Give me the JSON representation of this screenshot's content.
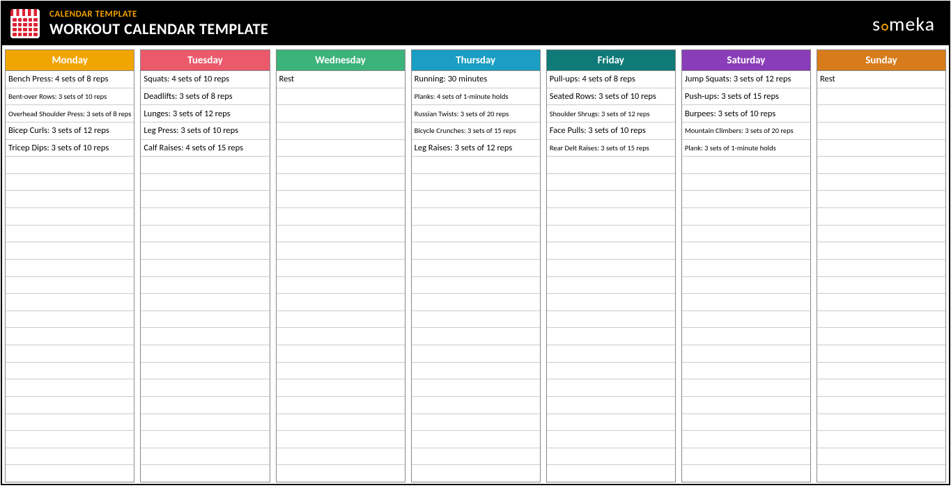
{
  "header": {
    "subtitle": "CALENDAR TEMPLATE",
    "title": "WORKOUT CALENDAR TEMPLATE",
    "brand": "someka"
  },
  "rows_per_col": 24,
  "days": [
    {
      "name": "Monday",
      "color": "#f0a500",
      "entries": [
        "Bench Press: 4 sets of 8 reps",
        "Bent-over Rows: 3 sets of 10 reps",
        "Overhead Shoulder Press: 3 sets of 8 reps",
        "Bicep Curls: 3 sets of 12 reps",
        "Tricep Dips: 3 sets of 10 reps"
      ]
    },
    {
      "name": "Tuesday",
      "color": "#ea5a6b",
      "entries": [
        "Squats: 4 sets of 10 reps",
        "Deadlifts: 3 sets of 8 reps",
        "Lunges: 3 sets of 12 reps",
        "Leg Press: 3 sets of 10 reps",
        "Calf Raises: 4 sets of 15 reps"
      ]
    },
    {
      "name": "Wednesday",
      "color": "#3cb37a",
      "entries": [
        "Rest"
      ]
    },
    {
      "name": "Thursday",
      "color": "#1a9ec3",
      "entries": [
        "Running: 30 minutes",
        "Planks: 4 sets of 1-minute holds",
        "Russian Twists: 3 sets of 20 reps",
        "Bicycle Crunches: 3 sets of 15 reps",
        "Leg Raises: 3 sets of 12 reps"
      ]
    },
    {
      "name": "Friday",
      "color": "#0f7a78",
      "entries": [
        "Pull-ups: 4 sets of 8 reps",
        "Seated Rows: 3 sets of 10 reps",
        "Shoulder Shrugs: 3 sets of 12 reps",
        "Face Pulls: 3 sets of 10 reps",
        "Rear Delt Raises: 3 sets of 15 reps"
      ]
    },
    {
      "name": "Saturday",
      "color": "#8a3db8",
      "entries": [
        "Jump Squats: 3 sets of 12 reps",
        "Push-ups: 3 sets of 15 reps",
        "Burpees: 3 sets of 10 reps",
        "Mountain Climbers: 3 sets of 20 reps",
        "Plank: 3 sets of 1-minute holds"
      ]
    },
    {
      "name": "Sunday",
      "color": "#d77b1b",
      "entries": [
        "Rest"
      ]
    }
  ]
}
